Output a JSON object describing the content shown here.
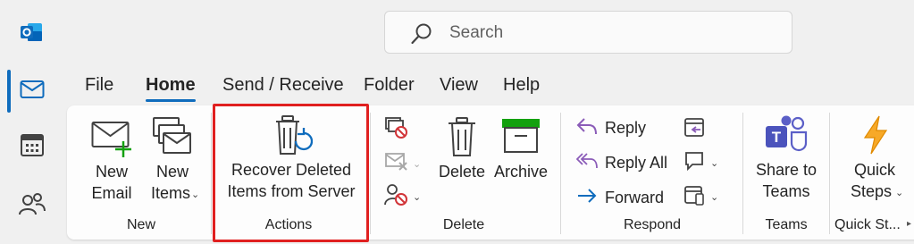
{
  "search": {
    "placeholder": "Search"
  },
  "tabs": [
    "File",
    "Home",
    "Send / Receive",
    "Folder",
    "View",
    "Help"
  ],
  "groups": {
    "new": {
      "label": "New",
      "new_email": [
        "New",
        "Email"
      ],
      "new_items": [
        "New",
        "Items"
      ]
    },
    "actions": {
      "label": "Actions",
      "recover": [
        "Recover Deleted",
        "Items from Server"
      ]
    },
    "delete": {
      "label": "Delete",
      "delete": "Delete",
      "archive": "Archive"
    },
    "respond": {
      "label": "Respond",
      "reply": "Reply",
      "reply_all": "Reply All",
      "forward": "Forward"
    },
    "teams": {
      "label": "Teams",
      "share": [
        "Share to",
        "Teams"
      ]
    },
    "quick_steps": {
      "label": "Quick St...",
      "quick": [
        "Quick",
        "Steps"
      ]
    }
  },
  "colors": {
    "accent": "#0f6cbd",
    "highlight": "#e02020",
    "green": "#13a10e",
    "red": "#d13438",
    "teams": "#5b5fc7",
    "bolt": "#f7a928"
  },
  "icons": [
    "outlook-logo-icon",
    "mail-icon",
    "calendar-icon",
    "people-icon",
    "search-icon"
  ]
}
